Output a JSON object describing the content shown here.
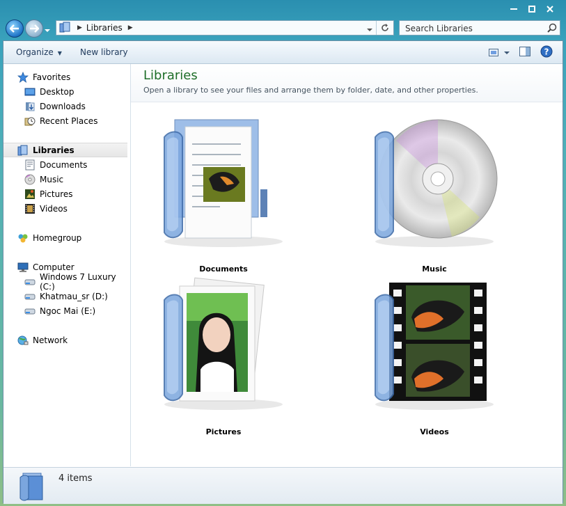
{
  "window": {
    "address": {
      "crumb": "Libraries"
    },
    "search": {
      "placeholder": "Search Libraries"
    }
  },
  "commands": {
    "organize": "Organize",
    "new_library": "New library"
  },
  "nav": {
    "favorites": {
      "label": "Favorites",
      "items": [
        {
          "label": "Desktop",
          "icon": "desktop-icon"
        },
        {
          "label": "Downloads",
          "icon": "downloads-icon"
        },
        {
          "label": "Recent Places",
          "icon": "recent-places-icon"
        }
      ]
    },
    "libraries": {
      "label": "Libraries",
      "items": [
        {
          "label": "Documents",
          "icon": "documents-icon"
        },
        {
          "label": "Music",
          "icon": "music-icon"
        },
        {
          "label": "Pictures",
          "icon": "pictures-icon"
        },
        {
          "label": "Videos",
          "icon": "videos-icon"
        }
      ]
    },
    "homegroup": {
      "label": "Homegroup"
    },
    "computer": {
      "label": "Computer",
      "items": [
        {
          "label": "Windows 7 Luxury (C:)",
          "icon": "drive-icon"
        },
        {
          "label": "Khatmau_sr (D:)",
          "icon": "drive-icon"
        },
        {
          "label": "Ngoc Mai (E:)",
          "icon": "drive-icon"
        }
      ]
    },
    "network": {
      "label": "Network"
    }
  },
  "main": {
    "title": "Libraries",
    "description": "Open a library to see your files and arrange them by folder, date, and other properties.",
    "libraries": [
      {
        "label": "Documents",
        "icon": "documents-library-icon"
      },
      {
        "label": "Music",
        "icon": "music-library-icon"
      },
      {
        "label": "Pictures",
        "icon": "pictures-library-icon"
      },
      {
        "label": "Videos",
        "icon": "videos-library-icon"
      }
    ]
  },
  "status": {
    "count": "4 items"
  },
  "colors": {
    "title_green": "#1e6e28",
    "folder_blue": "#5b8fd6",
    "frame_teal": "#2a8fb0"
  }
}
